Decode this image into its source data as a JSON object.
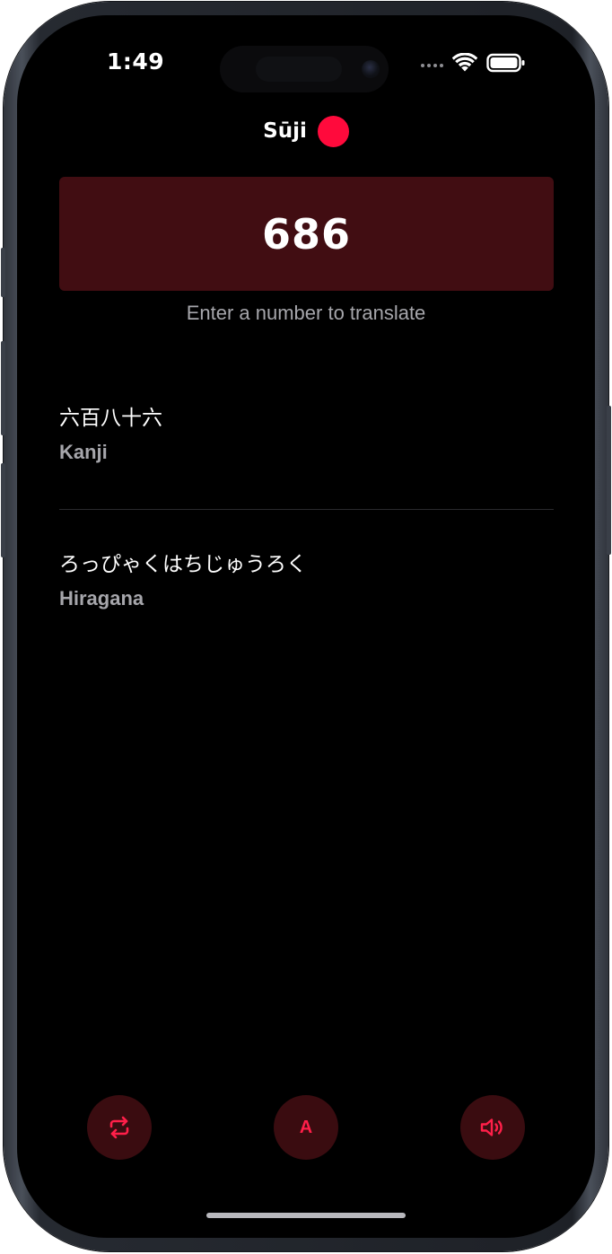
{
  "status_bar": {
    "time": "1:49",
    "signal_icon": "signal-dots-icon",
    "wifi_icon": "wifi-icon",
    "battery_icon": "battery-icon"
  },
  "header": {
    "title": "Sūji",
    "indicator_color": "#ff0a3c"
  },
  "number_input": {
    "value": "686",
    "background": "#410d12"
  },
  "hint": "Enter a number to translate",
  "results": [
    {
      "text": "六百八十六",
      "label": "Kanji"
    },
    {
      "text": "ろっぴゃくはちじゅうろく",
      "label": "Hiragana"
    }
  ],
  "toolbar": {
    "buttons": [
      {
        "icon": "repeat-icon"
      },
      {
        "icon": "letter-a-icon",
        "glyph": "A"
      },
      {
        "icon": "speaker-icon"
      }
    ],
    "accent": "#ff1f49",
    "button_background": "#3a0c10"
  }
}
